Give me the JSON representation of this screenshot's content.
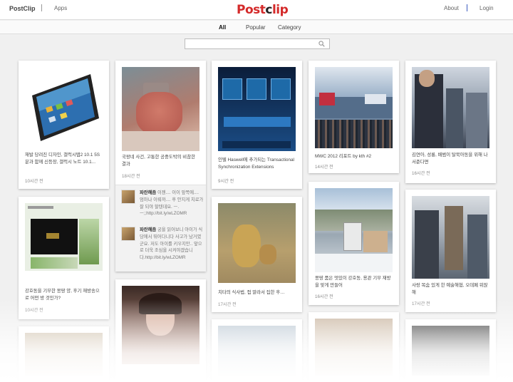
{
  "header": {
    "brand": "PostClip",
    "apps": "Apps",
    "logo_part1": "Post",
    "logo_o": "c",
    "logo_part2": "lip",
    "about": "About",
    "login": "Login"
  },
  "tabs": [
    {
      "label": "All",
      "active": true
    },
    {
      "label": "Popular",
      "active": false
    },
    {
      "label": "Category",
      "active": false
    }
  ],
  "search": {
    "placeholder": "",
    "value": ""
  },
  "cards": [
    {
      "title": "재발 당려진 디자인, 갤럭시탭2 10.1 5S분과 함께 신등장, 갤럭시 노트 10.1...",
      "time": "10시간 전",
      "thumb_icon": "tablet-image"
    },
    {
      "title": "국왕네 사건, 고통한 공중도박의 비참한 결과",
      "time": "18시간 전",
      "thumb_icon": "baby-photo"
    },
    {
      "title": "인텔 Haswell에 추가되는 Transactional Synchronization Extensions",
      "time": "9시간 전",
      "thumb_icon": "intel-slide"
    },
    {
      "title": "MWC 2012 리포트 by kth #2",
      "time": "14시간 전",
      "thumb_icon": "expo-crowd-photo"
    },
    {
      "title": "김연아, 성룡, 배범이 탈북아동을 위해 나서준다면",
      "time": "16시간 전",
      "thumb_icon": "rally-photo"
    },
    {
      "title": "강호동을 기부한 몽땅 양, 후기 재방송으로 어떤 방 것인가?",
      "time": "10시간 전",
      "thumb_icon": "screen-capture"
    },
    {
      "title": "치타의 식사법, 접 말라서 집한 후…",
      "time": "17시간 전",
      "thumb_icon": "cheetah-photo"
    },
    {
      "title": "몽땅 품은 멋있이 강호동, 용관 기부 재방을 맞게 만들어",
      "time": "16시간 전",
      "thumb_icon": "ski-resort-photo"
    },
    {
      "title": "사랑 목숨 있게 한 예술해협, 오데페 위않해",
      "time": "17시간 전",
      "thumb_icon": "protest-photo"
    }
  ],
  "comments": [
    {
      "author": "파란혜즘",
      "text": "이젠.... 이이 앞쪽에.... 엄마나 이뤄까.... 후 안지게 치료가 잘 되야 할텐데요. ㅡ.ㅡ;;http://bit.ly/wLZOMR"
    },
    {
      "author": "파란혜즘",
      "text": "궁을 읽어보니 아이가 식당에서 뛰어다니다 사고가 났거였군요. 저도 아이를 키우지만.. 앞으로 더욱 조심을 시켜야겠습니다.http://bit.ly/wLZOMR"
    }
  ],
  "colors": {
    "logo_red": "#d42a2a",
    "accent_blue": "#3b5bbf",
    "background": "#f0f0f0"
  }
}
